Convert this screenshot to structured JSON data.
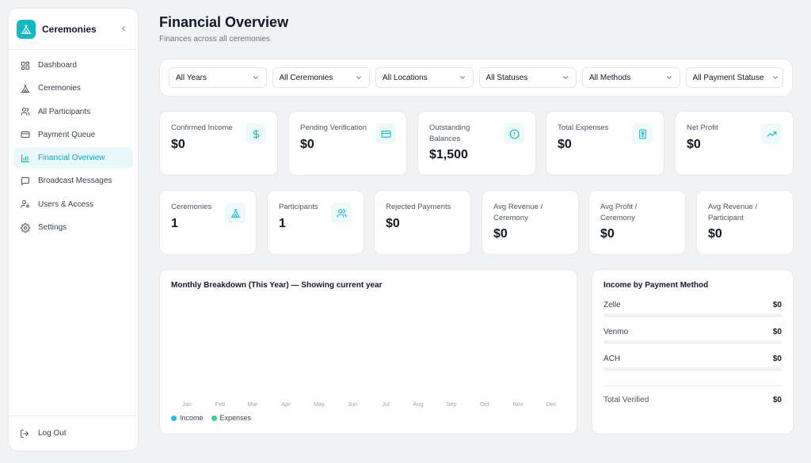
{
  "sidebar": {
    "brand": "Ceremonies",
    "items": [
      {
        "label": "Dashboard",
        "icon": "grid-icon"
      },
      {
        "label": "Ceremonies",
        "icon": "tent-icon"
      },
      {
        "label": "All Participants",
        "icon": "users-icon"
      },
      {
        "label": "Payment Queue",
        "icon": "credit-card-icon"
      },
      {
        "label": "Financial Overview",
        "icon": "bar-chart-icon",
        "active": true
      },
      {
        "label": "Broadcast Messages",
        "icon": "message-icon"
      },
      {
        "label": "Users & Access",
        "icon": "user-key-icon"
      },
      {
        "label": "Settings",
        "icon": "gear-icon"
      }
    ],
    "logout": "Log Out"
  },
  "header": {
    "title": "Financial Overview",
    "subtitle": "Finances across all ceremonies"
  },
  "filters": [
    "All Years",
    "All Ceremonies",
    "All Locations",
    "All Statuses",
    "All Methods",
    "All Payment Statuse"
  ],
  "stats_row1": [
    {
      "label": "Confirmed Income",
      "value": "$0",
      "icon": "dollar-icon"
    },
    {
      "label": "Pending Verification",
      "value": "$0",
      "icon": "card-icon"
    },
    {
      "label": "Outstanding Balances",
      "value": "$1,500",
      "icon": "alert-circle-icon"
    },
    {
      "label": "Total Expenses",
      "value": "$0",
      "icon": "receipt-icon"
    },
    {
      "label": "Net Profit",
      "value": "$0",
      "icon": "trending-up-icon"
    }
  ],
  "stats_row2": [
    {
      "label": "Ceremonies",
      "value": "1",
      "icon": "tent-icon"
    },
    {
      "label": "Participants",
      "value": "1",
      "icon": "users-icon"
    },
    {
      "label": "Rejected Payments",
      "value": "$0"
    },
    {
      "label": "Avg Revenue / Ceremony",
      "value": "$0"
    },
    {
      "label": "Avg Profit / Ceremony",
      "value": "$0"
    },
    {
      "label": "Avg Revenue / Participant",
      "value": "$0"
    }
  ],
  "monthly": {
    "title": "Monthly Breakdown (This Year) — Showing current year",
    "months": [
      "Jan",
      "Feb",
      "Mar",
      "Apr",
      "May",
      "Jun",
      "Jul",
      "Aug",
      "Sep",
      "Oct",
      "Nov",
      "Dec"
    ],
    "legend": {
      "income": "Income",
      "expenses": "Expenses"
    },
    "colors": {
      "income": "#22c3d6",
      "expenses": "#34d399"
    }
  },
  "payment_methods": {
    "title": "Income by Payment Method",
    "rows": [
      {
        "name": "Zelle",
        "amount": "$0"
      },
      {
        "name": "Venmo",
        "amount": "$0"
      },
      {
        "name": "ACH",
        "amount": "$0"
      }
    ],
    "total_label": "Total Verified",
    "total_amount": "$0"
  },
  "colors": {
    "accent": "#14b8c4",
    "accent_soft": "#e9f8fa"
  }
}
